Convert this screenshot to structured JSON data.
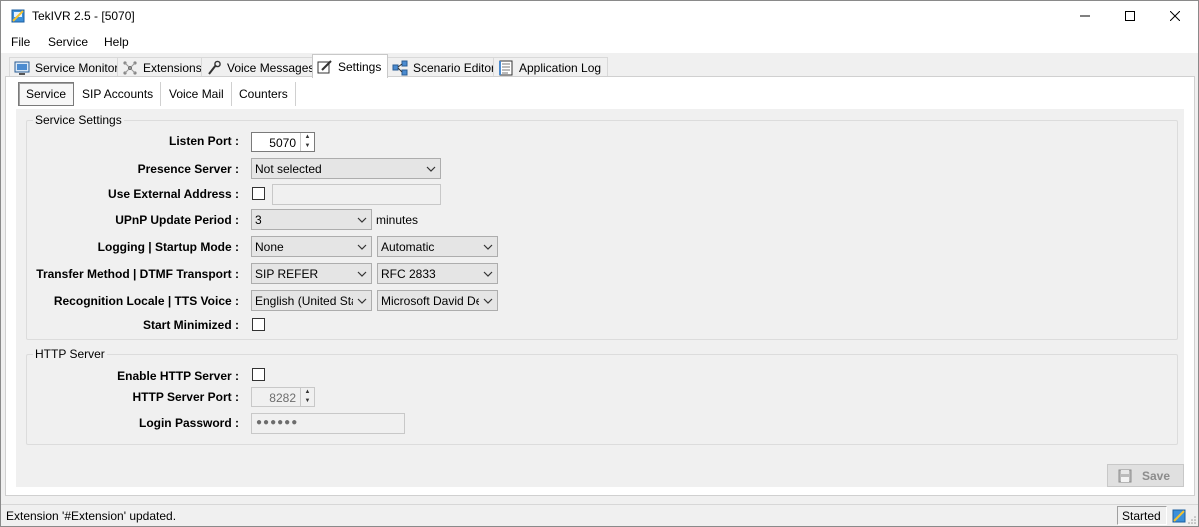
{
  "window": {
    "title": "TekIVR 2.5 - [5070]"
  },
  "menu": {
    "items": [
      "File",
      "Service",
      "Help"
    ]
  },
  "tabs": [
    {
      "label": "Service Monitor",
      "icon": "monitor-icon"
    },
    {
      "label": "Extensions",
      "icon": "network-icon"
    },
    {
      "label": "Voice Messages",
      "icon": "microphone-icon"
    },
    {
      "label": "Settings",
      "icon": "settings-pencil-icon"
    },
    {
      "label": "Scenario Editor",
      "icon": "flowchart-icon"
    },
    {
      "label": "Application Log",
      "icon": "log-document-icon"
    }
  ],
  "active_tab": "Settings",
  "subtabs": [
    "Service",
    "SIP Accounts",
    "Voice Mail",
    "Counters"
  ],
  "active_subtab": "Service",
  "service_settings": {
    "group_title": "Service Settings",
    "listen_port_label": "Listen Port :",
    "listen_port_value": "5070",
    "presence_server_label": "Presence Server :",
    "presence_server_value": "Not selected",
    "use_external_label": "Use External Address :",
    "use_external_checked": false,
    "external_address_value": "",
    "upnp_label": "UPnP Update Period :",
    "upnp_value": "3",
    "upnp_unit": "minutes",
    "logging_label": "Logging | Startup Mode :",
    "logging_value": "None",
    "startup_mode_value": "Automatic",
    "transfer_label": "Transfer Method | DTMF Transport :",
    "transfer_value": "SIP REFER",
    "dtmf_value": "RFC 2833",
    "recognition_label": "Recognition Locale | TTS Voice :",
    "recognition_value": "English (United States)",
    "tts_value": "Microsoft David Desktop",
    "start_minimized_label": "Start Minimized :",
    "start_minimized_checked": false
  },
  "http_server": {
    "group_title": "HTTP Server",
    "enable_label": "Enable HTTP Server :",
    "enable_checked": false,
    "port_label": "HTTP Server Port :",
    "port_value": "8282",
    "password_label": "Login Password :",
    "password_value": "●●●●●●"
  },
  "save_label": "Save",
  "status": {
    "message": "Extension '#Extension' updated.",
    "state": "Started"
  }
}
